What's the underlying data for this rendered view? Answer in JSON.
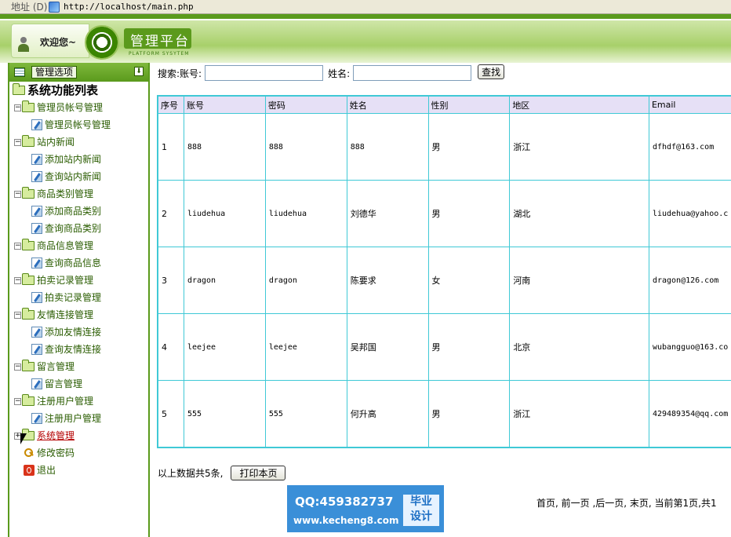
{
  "address_bar": {
    "label": "地址 (D)",
    "url": "http://localhost/main.php"
  },
  "header": {
    "welcome": "欢迎您~",
    "logo_title": "管理平台",
    "logo_subtitle": "PLATFORM SYSYTEM"
  },
  "sidebar": {
    "head_label": "管理选项",
    "tree_title": "系统功能列表",
    "groups": [
      {
        "label": "管理员帐号管理",
        "children": [
          "管理员帐号管理"
        ]
      },
      {
        "label": "站内新闻",
        "children": [
          "添加站内新闻",
          "查询站内新闻"
        ]
      },
      {
        "label": "商品类别管理",
        "children": [
          "添加商品类别",
          "查询商品类别"
        ]
      },
      {
        "label": "商品信息管理",
        "children": [
          "查询商品信息"
        ]
      },
      {
        "label": "拍卖记录管理",
        "children": [
          "拍卖记录管理"
        ]
      },
      {
        "label": "友情连接管理",
        "children": [
          "添加友情连接",
          "查询友情连接"
        ]
      },
      {
        "label": "留言管理",
        "children": [
          "留言管理"
        ]
      },
      {
        "label": "注册用户管理",
        "children": [
          "注册用户管理"
        ]
      },
      {
        "label": "系统管理",
        "children": []
      }
    ],
    "extra": [
      "修改密码",
      "退出"
    ]
  },
  "search": {
    "label": "搜索:账号:",
    "account_value": "",
    "name_label": "姓名:",
    "name_value": "",
    "button": "查找"
  },
  "table": {
    "headers": [
      "序号",
      "账号",
      "密码",
      "姓名",
      "性别",
      "地区",
      "Email"
    ],
    "rows": [
      [
        "1",
        "888",
        "888",
        "888",
        "男",
        "浙江",
        "dfhdf@163.com"
      ],
      [
        "2",
        "liudehua",
        "liudehua",
        "刘德华",
        "男",
        "湖北",
        "liudehua@yahoo.c"
      ],
      [
        "3",
        "dragon",
        "dragon",
        "陈要求",
        "女",
        "河南",
        "dragon@126.com"
      ],
      [
        "4",
        "leejee",
        "leejee",
        "吴邦国",
        "男",
        "北京",
        "wubangguo@163.co"
      ],
      [
        "5",
        "555",
        "555",
        "何升高",
        "男",
        "浙江",
        "429489354@qq.com"
      ]
    ]
  },
  "footer": {
    "summary": "以上数据共5条,",
    "print_button": "打印本页"
  },
  "watermark": {
    "qq": "QQ:459382737",
    "site": "www.kecheng8.com",
    "box_line1": "毕业",
    "box_line2": "设计"
  },
  "pager": "首页, 前一页 ,后一页, 末页, 当前第1页,共1"
}
